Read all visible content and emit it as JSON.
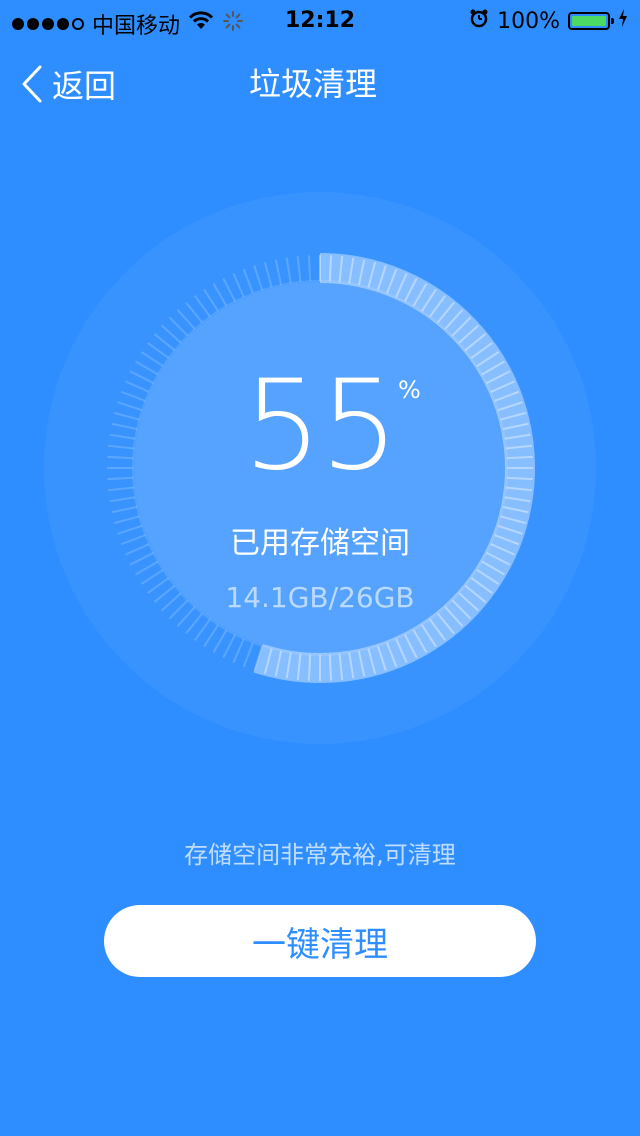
{
  "status_bar": {
    "carrier": "中国移动",
    "time": "12:12",
    "battery": "100%"
  },
  "nav": {
    "back_label": "返回",
    "title": "垃圾清理"
  },
  "storage": {
    "percent": "55",
    "percent_sign": "%",
    "used_label": "已用存储空间",
    "used_value": "14.1GB/26GB",
    "used_fraction": 0.55
  },
  "hint": "存储空间非常充裕,可清理",
  "action": {
    "button_label": "一键清理"
  },
  "colors": {
    "background": "#2E8EFF",
    "button_text": "#2E8EFF",
    "battery_green": "#4CD964"
  },
  "icons": {
    "back": "chevron-left-icon",
    "wifi": "wifi-icon",
    "activity": "loading-spinner-icon",
    "alarm": "alarm-icon",
    "charging": "charging-bolt-icon"
  }
}
